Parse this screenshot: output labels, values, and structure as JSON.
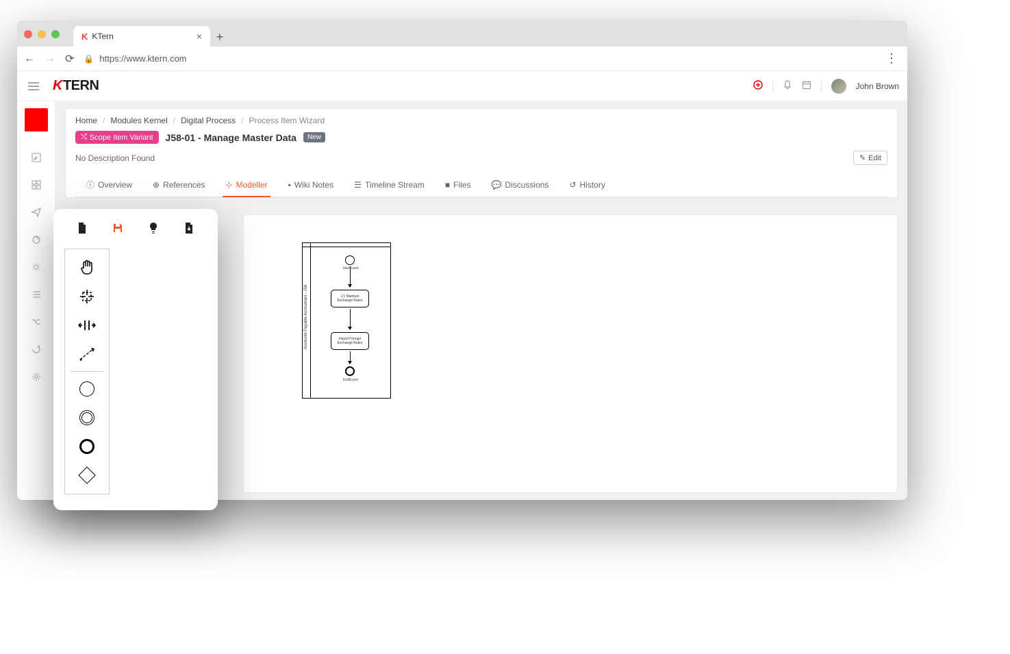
{
  "browser": {
    "tab_title": "KTern",
    "url": "https://www.ktern.com"
  },
  "header": {
    "logo": "TERN",
    "username": "John Brown"
  },
  "breadcrumb": {
    "items": [
      "Home",
      "Modules Kernel",
      "Digital Process"
    ],
    "current": "Process Item Wizard"
  },
  "page": {
    "badge_label": "Scope Item Variant",
    "title": "J58-01 - Manage Master Data",
    "new_badge": "New",
    "description": "No Description Found",
    "edit_label": "Edit"
  },
  "tabs": {
    "overview": "Overview",
    "references": "References",
    "modeller": "Modeller",
    "wiki": "Wiki Notes",
    "timeline": "Timeline Stream",
    "files": "Files",
    "discussions": "Discussions",
    "history": "History"
  },
  "bpmn": {
    "lane_label": "Accounts Payable Accountant - J58",
    "start_label": "StartEvent",
    "task1": "J.1 Maintain Exchange Rates",
    "task2": "Import Foreign Exchange Rates",
    "end_label": "EndEvent"
  }
}
